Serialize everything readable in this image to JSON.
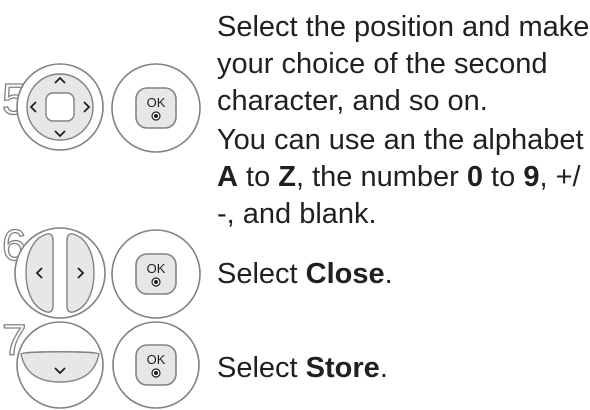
{
  "steps": [
    {
      "number": "5",
      "buttons": [
        "navigation-pad",
        "ok-button"
      ],
      "lines": [
        [
          "Select the position and make"
        ],
        [
          "your choice of the second"
        ],
        [
          "character, and so on."
        ],
        [
          "You can use an the alphabet"
        ],
        [
          {
            "b": "A"
          },
          " to ",
          {
            "b": "Z"
          },
          ", the number ",
          {
            "b": "0"
          },
          " to ",
          {
            "b": "9"
          },
          ", +/"
        ],
        [
          "-, and blank."
        ]
      ]
    },
    {
      "number": "6",
      "buttons": [
        "left-right-buttons",
        "ok-button"
      ],
      "lines": [
        [
          "Select ",
          {
            "b": "Close"
          },
          "."
        ]
      ]
    },
    {
      "number": "7",
      "buttons": [
        "down-button",
        "ok-button"
      ],
      "lines": [
        [
          "Select ",
          {
            "b": "Store"
          },
          "."
        ]
      ]
    }
  ],
  "ok_label": "OK",
  "icons": [
    "up-arrow-icon",
    "down-arrow-icon",
    "left-arrow-icon",
    "right-arrow-icon"
  ]
}
